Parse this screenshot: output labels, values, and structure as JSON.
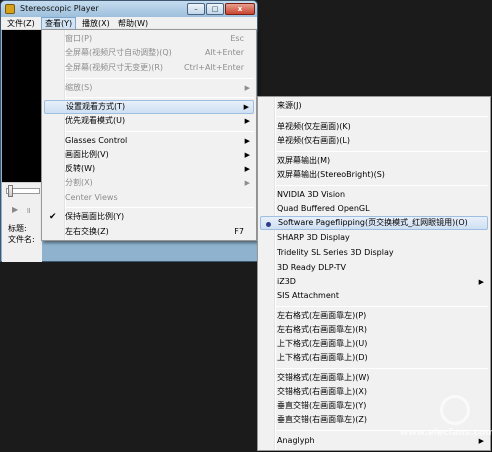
{
  "window": {
    "title": "Stereoscopic Player",
    "minimize_glyph": "–",
    "maximize_glyph": "□",
    "close_glyph": "x"
  },
  "menubar": {
    "items": [
      {
        "label": "文件(Z)"
      },
      {
        "label": "查看(Y)"
      },
      {
        "label": "播放(X)"
      },
      {
        "label": "帮助(W)"
      }
    ]
  },
  "player": {
    "play_glyph": "▶",
    "pause_glyph": "॥",
    "title_label": "标题:",
    "file_label": "文件名:"
  },
  "view_menu": {
    "items": [
      {
        "label": "窗口(P)",
        "shortcut": "Esc",
        "disabled": true
      },
      {
        "label": "全屏幕(视频尺寸自动调整)(Q)",
        "shortcut": "Alt+Enter",
        "disabled": true
      },
      {
        "label": "全屏幕(视频尺寸无变更)(R)",
        "shortcut": "Ctrl+Alt+Enter",
        "disabled": true
      },
      {
        "label": "缩放(S)",
        "submenu": true,
        "disabled": true
      },
      {
        "label": "设置观看方式(T)",
        "submenu": true,
        "highlighted": true
      },
      {
        "label": "优先观看模式(U)",
        "submenu": true
      },
      {
        "label": "Glasses Control",
        "submenu": true
      },
      {
        "label": "画面比例(V)",
        "submenu": true
      },
      {
        "label": "反转(W)",
        "submenu": true
      },
      {
        "label": "分割(X)",
        "submenu": true,
        "disabled": true
      },
      {
        "label": "Center Views",
        "disabled": true
      },
      {
        "label": "保持画面比例(Y)",
        "checked": true
      },
      {
        "label": "左右交换(Z)",
        "shortcut": "F7"
      }
    ],
    "check_glyph": "✔",
    "arrow_glyph": "▶"
  },
  "viewing_submenu": {
    "items": [
      {
        "label": "来源(J)"
      },
      {
        "label": "单视频(仅左画面)(K)"
      },
      {
        "label": "单视频(仅右画面)(L)"
      },
      {
        "label": "双屏幕输出(M)"
      },
      {
        "label": "双屏幕输出(StereoBright)(S)"
      },
      {
        "label": "NVIDIA 3D Vision"
      },
      {
        "label": "Quad Buffered OpenGL"
      },
      {
        "label": "Software Pageflipping(页交换模式_红网眼镜用)(O)",
        "selected": true
      },
      {
        "label": "SHARP 3D Display"
      },
      {
        "label": "Tridelity SL Series 3D Display"
      },
      {
        "label": "3D Ready DLP-TV"
      },
      {
        "label": "iZ3D",
        "submenu": true
      },
      {
        "label": "SIS Attachment"
      },
      {
        "label": "左右格式(左画面靠左)(P)"
      },
      {
        "label": "左右格式(右画面靠左)(R)"
      },
      {
        "label": "上下格式(左画面靠上)(U)"
      },
      {
        "label": "上下格式(右画面靠上)(D)"
      },
      {
        "label": "交错格式(左画面靠上)(W)"
      },
      {
        "label": "交错格式(右画面靠上)(X)"
      },
      {
        "label": "垂直交错(左画面靠左)(Y)"
      },
      {
        "label": "垂直交错(右画面靠左)(Z)"
      },
      {
        "label": "Anaglyph",
        "submenu": true
      }
    ],
    "arrow_glyph": "▶"
  },
  "watermark": {
    "text": "www.elecfans.com"
  }
}
